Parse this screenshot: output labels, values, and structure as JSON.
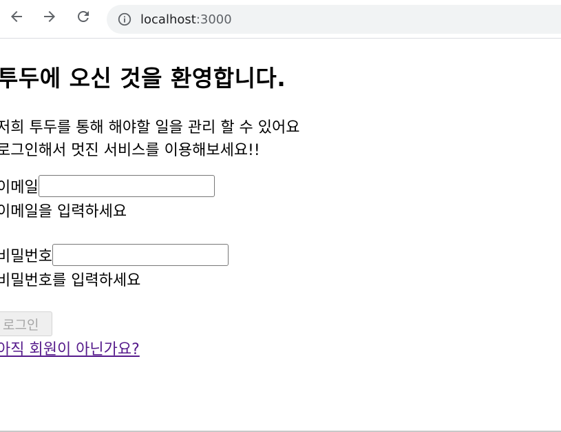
{
  "browser": {
    "url_host": "localhost",
    "url_port": ":3000",
    "back_icon": "back-arrow-icon",
    "forward_icon": "forward-arrow-icon",
    "reload_icon": "reload-icon",
    "site_info_icon": "info-icon"
  },
  "page": {
    "title": "투두에 오신 것을 환영합니다.",
    "intro_line_1": "저희 투두를 통해 해야할 일을 관리 할 수 있어요",
    "intro_line_2": "로그인해서 멋진 서비스를 이용해보세요!!",
    "email": {
      "label": "이메일",
      "value": "",
      "hint": "이메일을 입력하세요"
    },
    "password": {
      "label": "비밀번호",
      "value": "",
      "hint": "비밀번호를 입력하세요"
    },
    "login_button": "로그인",
    "signup_link": "아직 회원이 아닌가요?"
  }
}
